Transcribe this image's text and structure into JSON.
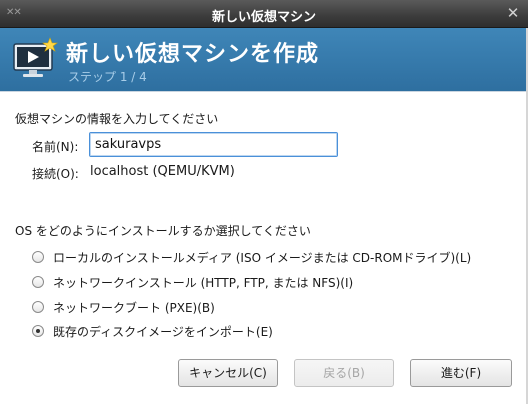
{
  "window": {
    "title": "新しい仮想マシン",
    "wm_icon": "✕✕",
    "close_glyph": "✕"
  },
  "banner": {
    "heading": "新しい仮想マシンを作成",
    "step": "ステップ 1 / 4",
    "icon": "monitor-play-icon"
  },
  "info": {
    "section_label": "仮想マシンの情報を入力してください",
    "name_label": "名前(N):",
    "name_value": "sakuravps",
    "connection_label": "接続(O):",
    "connection_value": "localhost (QEMU/KVM)"
  },
  "install": {
    "section_label": "OS をどのようにインストールするか選択してください",
    "options": [
      {
        "label": "ローカルのインストールメディア (ISO イメージまたは CD-ROMドライブ)(L)",
        "checked": false
      },
      {
        "label": "ネットワークインストール (HTTP, FTP, または NFS)(I)",
        "checked": false
      },
      {
        "label": "ネットワークブート (PXE)(B)",
        "checked": false
      },
      {
        "label": "既存のディスクイメージをインポート(E)",
        "checked": true
      }
    ]
  },
  "buttons": {
    "cancel": "キャンセル(C)",
    "back": "戻る(B)",
    "forward": "進む(F)"
  },
  "colors": {
    "banner": "#3a7fb2",
    "focus": "#4a90d9"
  }
}
